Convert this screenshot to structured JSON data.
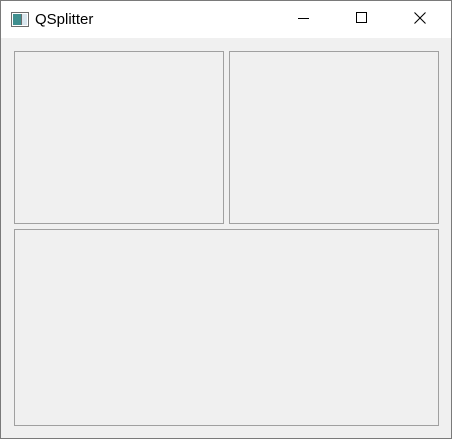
{
  "window": {
    "title": "QSplitter",
    "app_icon": "qt-window-icon",
    "controls": {
      "minimize_icon": "minimize-icon",
      "maximize_icon": "maximize-icon",
      "close_icon": "close-icon"
    }
  },
  "splitter": {
    "orientation_outer": "vertical",
    "orientation_inner": "horizontal",
    "panes": [
      {
        "name": "top-left-frame"
      },
      {
        "name": "top-right-frame"
      },
      {
        "name": "bottom-frame"
      }
    ]
  },
  "colors": {
    "titlebar_bg": "#ffffff",
    "client_bg": "#f0f0f0",
    "frame_border": "#a0a0a0",
    "window_border": "#7a7a7a"
  }
}
